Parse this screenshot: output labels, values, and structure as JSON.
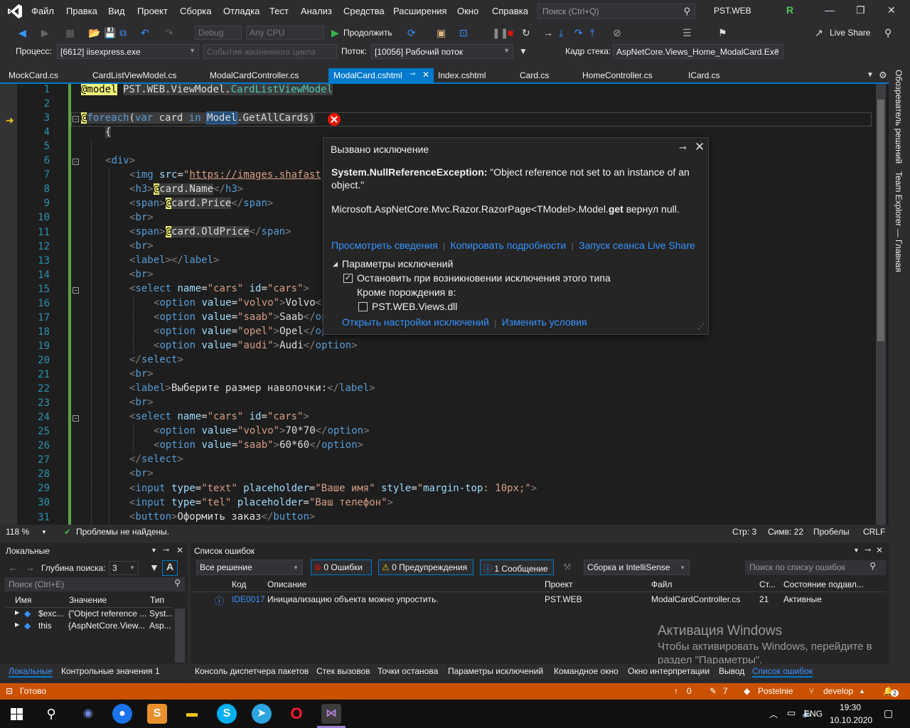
{
  "menu": [
    "Файл",
    "Правка",
    "Вид",
    "Проект",
    "Сборка",
    "Отладка",
    "Тест",
    "Анализ",
    "Средства",
    "Расширения",
    "Окно",
    "Справка"
  ],
  "quicksearch_placeholder": "Поиск (Ctrl+Q)",
  "solution_name": "PST.WEB",
  "avatar_letter": "R",
  "toolbar": {
    "config": "Debug",
    "platform": "Any CPU",
    "continue": "Продолжить",
    "liveshare": "Live Share"
  },
  "debugbar": {
    "process_label": "Процесс:",
    "process_value": "[6612] iisexpress.exe",
    "lifecycle": "События жизненного цикла",
    "thread_label": "Поток:",
    "thread_value": "[10056] Рабочий поток",
    "stackframe_label": "Кадр стека:",
    "stackframe_value": "AspNetCore.Views_Home_ModalCard.Exe"
  },
  "tabs": [
    "MockCard.cs",
    "CardListViewModel.cs",
    "ModalCardController.cs",
    "ModalCard.cshtml",
    "Index.cshtml",
    "Card.cs",
    "HomeController.cs",
    "ICard.cs"
  ],
  "active_tab": "ModalCard.cshtml",
  "line_numbers": [
    "1",
    "2",
    "3",
    "4",
    "5",
    "6",
    "7",
    "8",
    "9",
    "10",
    "11",
    "12",
    "13",
    "14",
    "15",
    "16",
    "17",
    "18",
    "19",
    "20",
    "21",
    "22",
    "23",
    "24",
    "25",
    "26",
    "27",
    "28",
    "29",
    "30",
    "31"
  ],
  "exception": {
    "title": "Вызвано исключение",
    "type": "System.NullReferenceException:",
    "message": " \"Object reference not set to an instance of an object.\"",
    "detail_prefix": "Microsoft.AspNetCore.Mvc.Razor.RazorPage<TModel>.Model.",
    "detail_bold": "get",
    "detail_suffix": " вернул null.",
    "link_view": "Просмотреть сведения",
    "link_copy": "Копировать подробности",
    "link_liveshare": "Запуск сеанса Live Share",
    "settings_header": "Параметры исключений",
    "break_when": "Остановить при возникновении исключения этого типа",
    "except_from": "Кроме порождения в:",
    "dll": "PST.WEB.Views.dll",
    "link_open": "Открыть настройки исключений",
    "link_edit": "Изменить условия"
  },
  "editor_status": {
    "zoom": "118 %",
    "problems": "Проблемы не найдены.",
    "line": "Стр: 3",
    "col": "Симв: 22",
    "spaces": "Пробелы",
    "eol": "CRLF"
  },
  "locals": {
    "title": "Локальные",
    "depth_label": "Глубина поиска:",
    "depth_value": "3",
    "search_placeholder": "Поиск (Ctrl+E)",
    "headers": [
      "Имя",
      "Значение",
      "Тип"
    ],
    "rows": [
      {
        "name": "$exc...",
        "value": "{\"Object reference ...",
        "type": "Syst..."
      },
      {
        "name": "this",
        "value": "{AspNetCore.View...",
        "type": "Asp..."
      }
    ]
  },
  "errors": {
    "title": "Список ошибок",
    "scope": "Все решение",
    "errors_btn": "0 Ошибки",
    "warnings_btn": "0 Предупреждения",
    "messages_btn": "1 Сообщение",
    "build_filter": "Сборка и IntelliSense",
    "search_placeholder": "Поиск по списку ошибок",
    "headers": [
      "Код",
      "Описание",
      "Проект",
      "Файл",
      "Ст...",
      "Состояние подавл..."
    ],
    "row": {
      "code": "IDE0017",
      "desc": "Инициализацию объекта можно упростить.",
      "project": "PST.WEB",
      "file": "ModalCardController.cs",
      "line": "21",
      "state": "Активные"
    }
  },
  "activation": {
    "title": "Активация Windows",
    "text": "Чтобы активировать Windows, перейдите в раздел \"Параметры\"."
  },
  "tooltabs_left": [
    "Локальные",
    "Контрольные значения 1"
  ],
  "tooltabs_right": [
    "Консоль диспетчера пакетов",
    "Стек вызовов",
    "Точки останова",
    "Параметры исключений",
    "Командное окно",
    "Окно интерпретации",
    "Вывод",
    "Список ошибок"
  ],
  "side_panels": [
    "Обозреватель решений",
    "Team Explorer — Главная"
  ],
  "statusbar": {
    "ready": "Готово",
    "up": "0",
    "pencil": "7",
    "repo": "Postelnie",
    "branch": "develop",
    "bell": "2"
  },
  "taskbar": {
    "lang": "ENG",
    "time": "19:30",
    "date": "10.10.2020"
  },
  "colors": {
    "accent": "#007acc",
    "status": "#ca5100"
  }
}
